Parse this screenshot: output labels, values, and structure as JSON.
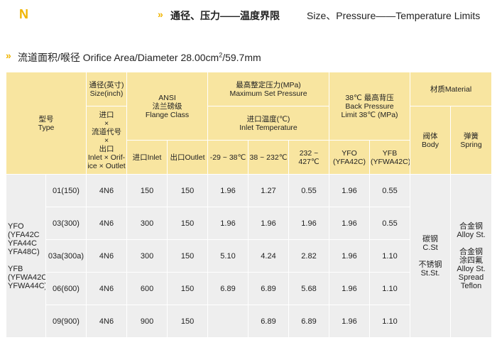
{
  "header": {
    "series_letter": "N",
    "arrow": "»",
    "title_cn": "通径、压力——温度界限",
    "title_en": "Size、Pressure——Temperature Limits"
  },
  "section": {
    "arrow": "»",
    "title_main": "流道面积/喉径 Orifice Area/Diameter 28.00cm",
    "title_sup": "2",
    "title_end": "/59.7mm"
  },
  "table": {
    "headers": {
      "type_cn": "型号",
      "type_en": "Type",
      "size_cn": "通径(英寸)",
      "size_en": "Size(inch)",
      "size_code_lines": [
        "进口",
        "×",
        "流道代号",
        "×",
        "出口",
        "Inlet × Orif-",
        "ice × Outlet"
      ],
      "ansi_en": "ANSI",
      "ansi_cn": "法兰磅级",
      "ansi_flange": "Flange Class",
      "mset_cn": "最高整定压力(MPa)",
      "mset_en": "Maximum Set Pressure",
      "inlet_temp_cn": "进口温度(℃)",
      "inlet_temp_en": "Inlet Temperature",
      "backp_cn": "38℃ 最高背压",
      "backp_en1": "Back Pressure",
      "backp_en2": "Limit 38℃ (MPa)",
      "material": "材质Material",
      "body_cn": "阀体",
      "body_en": "Body",
      "spring_cn": "弹簧",
      "spring_en": "Spring",
      "inlet": "进口Inlet",
      "outlet": "出口Outlet",
      "temp1": "-29 ~ 38℃",
      "temp2": "38 ~ 232℃",
      "temp3": "232 ~ 427℃",
      "yfo_cn": "YFO",
      "yfo_en": "(YFA42C)",
      "yfb_cn": "YFB",
      "yfb_en": "(YFWA42C)"
    },
    "type_lines": [
      "YFO",
      "(YFA42C",
      "YFA44C",
      "YFA48C)",
      "",
      "YFB",
      "(YFWA42C",
      "YFWA44C)"
    ],
    "body_lines": [
      "碳钢",
      "C.St",
      "",
      "不锈钢",
      "St.St."
    ],
    "spring_lines": [
      "合金钢",
      "Alloy St.",
      "",
      "合金钢",
      "涂四氟",
      "Alloy St.",
      "Spread",
      "Teflon"
    ],
    "rows": [
      {
        "size": "01(150)",
        "code": "4N6",
        "inlet": "150",
        "outlet": "150",
        "t1": "1.96",
        "t2": "1.27",
        "t3": "0.55",
        "yfo": "1.96",
        "yfb": "0.55"
      },
      {
        "size": "03(300)",
        "code": "4N6",
        "inlet": "300",
        "outlet": "150",
        "t1": "1.96",
        "t2": "1.96",
        "t3": "1.96",
        "yfo": "1.96",
        "yfb": "0.55"
      },
      {
        "size": "03a(300a)",
        "code": "4N6",
        "inlet": "300",
        "outlet": "150",
        "t1": "5.10",
        "t2": "4.24",
        "t3": "2.82",
        "yfo": "1.96",
        "yfb": "1.10"
      },
      {
        "size": "06(600)",
        "code": "4N6",
        "inlet": "600",
        "outlet": "150",
        "t1": "6.89",
        "t2": "6.89",
        "t3": "5.68",
        "yfo": "1.96",
        "yfb": "1.10"
      },
      {
        "size": "09(900)",
        "code": "4N6",
        "inlet": "900",
        "outlet": "150",
        "t1": "",
        "t2": "6.89",
        "t3": "6.89",
        "yfo": "1.96",
        "yfb": "1.10"
      }
    ],
    "colors": {
      "header_bg": "#f8e5a0",
      "body_bg": "#eeeeee",
      "accent": "#f0b400"
    }
  }
}
